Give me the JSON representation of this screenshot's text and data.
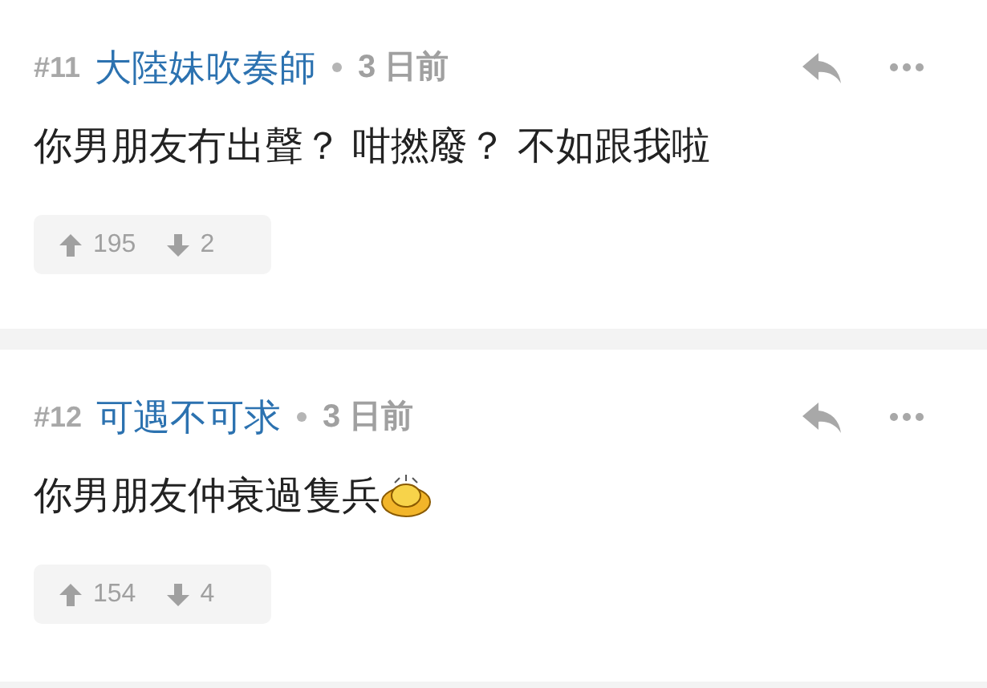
{
  "comments": [
    {
      "number": "#11",
      "author": "大陸妹吹奏師",
      "time": "3 日前",
      "body": "你男朋友冇出聲？ 咁撚廢？ 不如跟我啦",
      "emoticon": false,
      "upvotes": "195",
      "downvotes": "2"
    },
    {
      "number": "#12",
      "author": "可遇不可求",
      "time": "3 日前",
      "body": "你男朋友仲衰過隻兵",
      "emoticon": true,
      "upvotes": "154",
      "downvotes": "4"
    }
  ]
}
